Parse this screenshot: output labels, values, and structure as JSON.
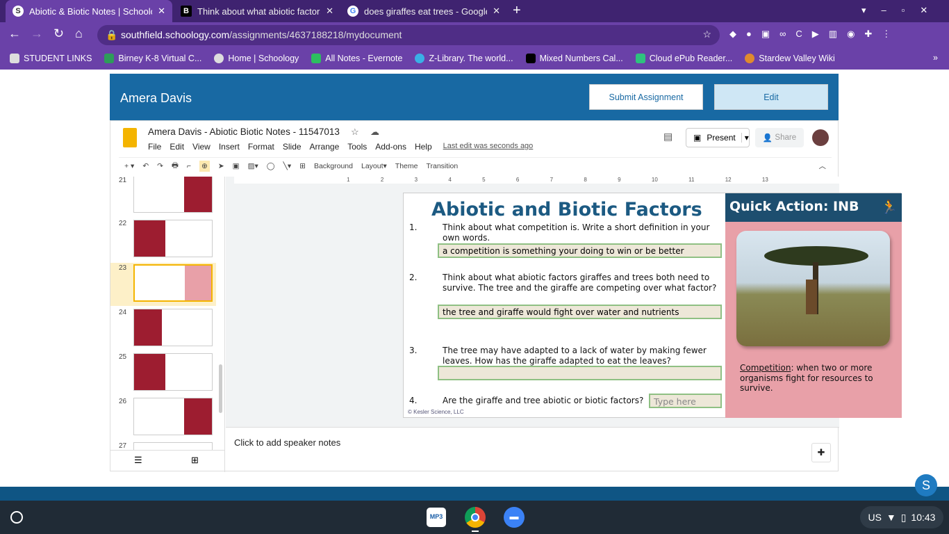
{
  "browser": {
    "tabs": [
      {
        "label": "Abiotic & Biotic Notes | Schoology",
        "icon": "S",
        "active": true
      },
      {
        "label": "Think about what abiotic factors",
        "icon": "B"
      },
      {
        "label": "does giraffes eat trees - Google S",
        "icon": "G"
      }
    ],
    "url_host": "southfield.schoology.com",
    "url_path": "/assignments/4637188218/mydocument",
    "bookmarks": [
      "STUDENT LINKS",
      "Birney K-8 Virtual C...",
      "Home | Schoology",
      "All Notes - Evernote",
      "Z-Library. The world...",
      "Mixed Numbers Cal...",
      "Cloud ePub Reader...",
      "Stardew Valley Wiki"
    ]
  },
  "schoology": {
    "student": "Amera Davis",
    "submit": "Submit Assignment",
    "edit": "Edit"
  },
  "doc": {
    "title": "Amera Davis - Abiotic  Biotic Notes - 11547013",
    "menu": [
      "File",
      "Edit",
      "View",
      "Insert",
      "Format",
      "Slide",
      "Arrange",
      "Tools",
      "Add-ons",
      "Help"
    ],
    "last_edit": "Last edit was seconds ago",
    "present": "Present",
    "share": "Share",
    "toolbar": {
      "background": "Background",
      "layout": "Layout",
      "theme": "Theme",
      "transition": "Transition"
    },
    "slide_numbers": [
      "21",
      "22",
      "23",
      "24",
      "25",
      "26",
      "27"
    ],
    "ruler": [
      "1",
      "2",
      "3",
      "4",
      "5",
      "6",
      "7",
      "8",
      "9",
      "10",
      "11",
      "12",
      "13"
    ],
    "notes_placeholder": "Click to add speaker notes"
  },
  "slide": {
    "title": "Abiotic and Biotic Factors",
    "questions": [
      {
        "num": "1.",
        "text": "Think about what competition is. Write a short definition in your own words.",
        "answer": "a competition is something your doing to win or be better"
      },
      {
        "num": "2.",
        "text": "Think about what abiotic factors giraffes and trees both need to survive. The tree and the giraffe are competing over what factor?",
        "answer": "the tree and giraffe would fight over water and nutrients"
      },
      {
        "num": "3.",
        "text": "The tree may have adapted to a lack of water by making fewer leaves.  How has the giraffe adapted to eat the leaves?",
        "answer": ""
      },
      {
        "num": "4.",
        "text": "Are the giraffe and tree abiotic or biotic factors?",
        "placeholder": "Type here"
      }
    ],
    "copyright": "© Kesler Science, LLC",
    "panel_title": "Quick Action: INB",
    "definition_term": "Competition",
    "definition_text": ": when two or more organisms fight for resources to survive."
  },
  "os": {
    "keyboard": "US",
    "time": "10:43",
    "avatar": "S"
  }
}
